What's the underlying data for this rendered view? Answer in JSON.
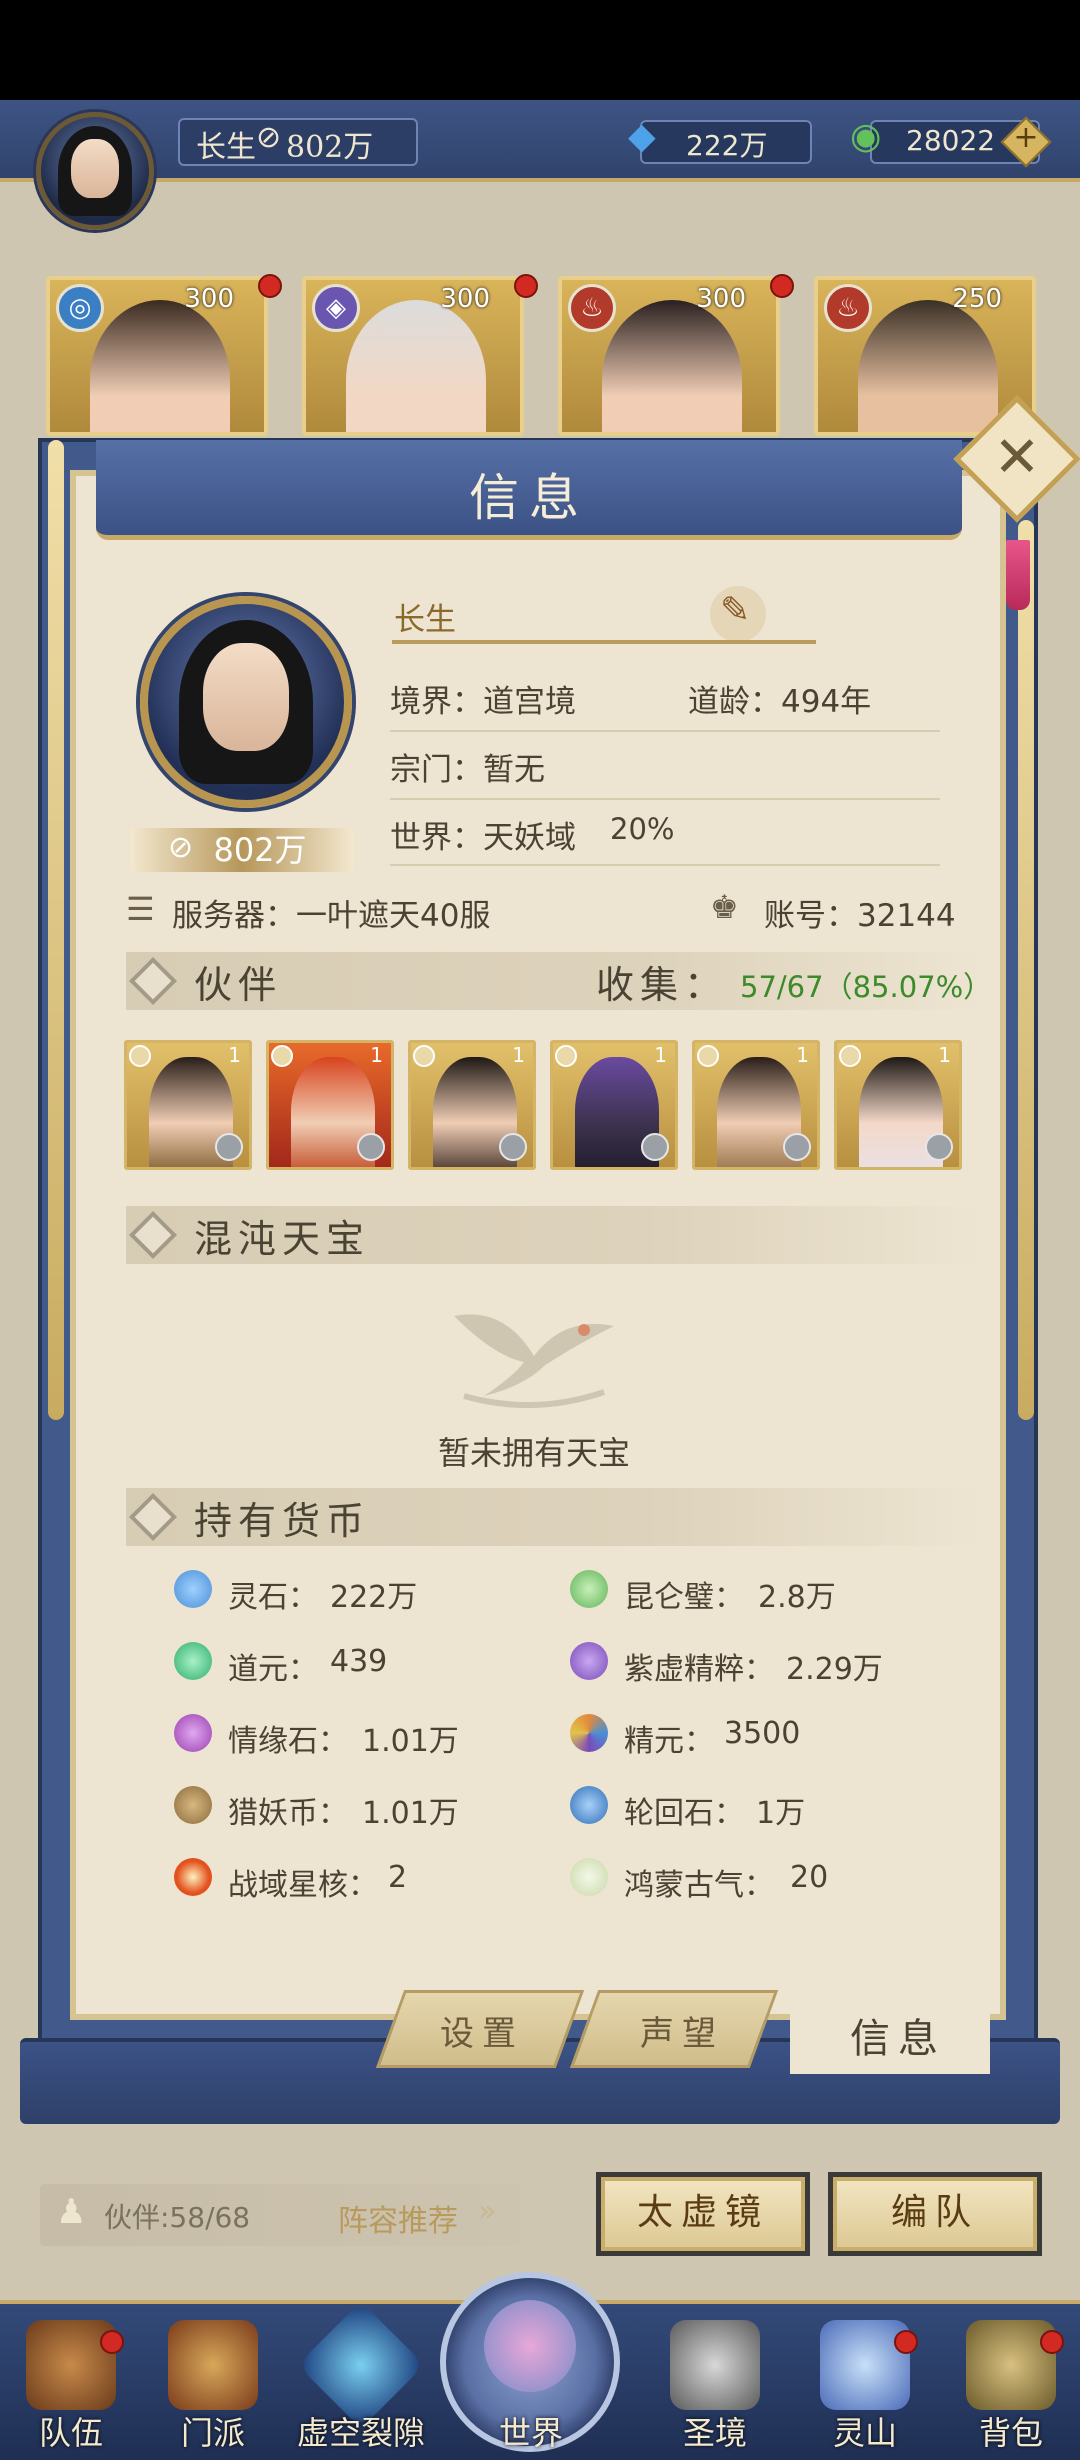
{
  "top_bar": {
    "player_name": "长生",
    "power": "802万",
    "spirit_stone": "222万",
    "jade": "28022"
  },
  "heroes": [
    {
      "level": "300",
      "element_color": "#3a7fc3"
    },
    {
      "level": "300",
      "element_color": "#6a55b0"
    },
    {
      "level": "300",
      "element_color": "#b23a2a"
    },
    {
      "level": "250",
      "element_color": "#b23a2a"
    }
  ],
  "panel": {
    "title": "信息",
    "name": "长生",
    "realm": "境界：道宫境",
    "age": "道龄：494年",
    "sect": "宗门：暂无",
    "world": "世界：天妖域",
    "world_pct": "20%",
    "power": "802万",
    "server": "服务器：一叶遮天40服",
    "account": "账号：32144"
  },
  "partners": {
    "title": "伙伴",
    "collect_label": "收集：",
    "collect_value": "57/67（85.07%）",
    "items": [
      {
        "level": "1",
        "color": "#7a5a2a"
      },
      {
        "level": "1",
        "color": "#c0441e"
      },
      {
        "level": "1",
        "color": "#3b2a20"
      },
      {
        "level": "1",
        "color": "#3d3350"
      },
      {
        "level": "1",
        "color": "#8f6a3e"
      },
      {
        "level": "1",
        "color": "#4a3a40"
      }
    ]
  },
  "treasure": {
    "title": "混沌天宝",
    "empty_text": "暂未拥有天宝"
  },
  "currency": {
    "title": "持有货币",
    "items": [
      {
        "label": "灵石：",
        "value": "222万",
        "icon": "spirit-stone-icon",
        "color": "#4b8fd6"
      },
      {
        "label": "昆仑璧：",
        "value": "2.8万",
        "icon": "kunlun-jade-icon",
        "color": "#5fb35a"
      },
      {
        "label": "道元：",
        "value": "439",
        "icon": "dao-yuan-icon",
        "color": "#2fae6a"
      },
      {
        "label": "紫虚精粹：",
        "value": "2.29万",
        "icon": "purple-essence-icon",
        "color": "#7a4bb8"
      },
      {
        "label": "情缘石：",
        "value": "1.01万",
        "icon": "affinity-stone-icon",
        "color": "#9a3fb0"
      },
      {
        "label": "精元：",
        "value": "3500",
        "icon": "essence-icon",
        "color": "#e38a3a"
      },
      {
        "label": "猎妖币：",
        "value": "1.01万",
        "icon": "demon-coin-icon",
        "color": "#8a6a3a"
      },
      {
        "label": "轮回石：",
        "value": "1万",
        "icon": "samsara-stone-icon",
        "color": "#2f6fb8"
      },
      {
        "label": "战域星核：",
        "value": "2",
        "icon": "star-core-icon",
        "color": "#e2521e"
      },
      {
        "label": "鸿蒙古气：",
        "value": "20",
        "icon": "primordial-qi-icon",
        "color": "#c9d8a8"
      }
    ]
  },
  "tabs": {
    "settings": "设置",
    "reputation": "声望",
    "info": "信息"
  },
  "team": {
    "count": "伙伴:58/68",
    "recommend": "阵容推荐",
    "mirror_button": "太虚镜",
    "formation_button": "编队"
  },
  "nav": [
    {
      "label": "队伍"
    },
    {
      "label": "门派"
    },
    {
      "label": "虚空裂隙"
    },
    {
      "label": "世界"
    },
    {
      "label": "圣境"
    },
    {
      "label": "灵山"
    },
    {
      "label": "背包"
    }
  ]
}
